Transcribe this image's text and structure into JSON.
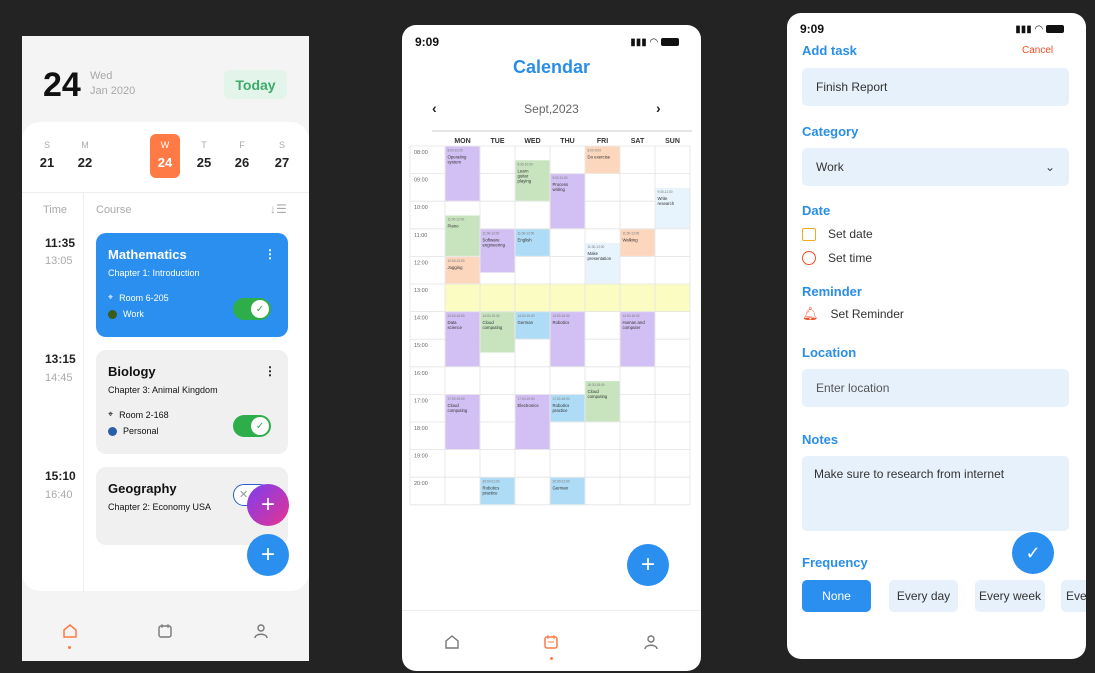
{
  "screen1": {
    "day": "24",
    "weekday": "Wed",
    "month_year": "Jan 2020",
    "today_label": "Today",
    "week": [
      {
        "letter": "S",
        "num": "21"
      },
      {
        "letter": "M",
        "num": "22"
      },
      {
        "letter": "W",
        "num": "24"
      },
      {
        "letter": "T",
        "num": "25"
      },
      {
        "letter": "F",
        "num": "26"
      },
      {
        "letter": "S",
        "num": "27"
      }
    ],
    "col_time": "Time",
    "col_course": "Course",
    "courses": [
      {
        "start": "11:35",
        "end": "13:05",
        "title": "Mathematics",
        "chapter": "Chapter 1: Introduction",
        "room": "Room 6-205",
        "tag": "Work"
      },
      {
        "start": "13:15",
        "end": "14:45",
        "title": "Biology",
        "chapter": "Chapter 3: Animal Kingdom",
        "room": "Room 2-168",
        "tag": "Personal"
      },
      {
        "start": "15:10",
        "end": "16:40",
        "title": "Geography",
        "chapter": "Chapter 2: Economy USA"
      }
    ],
    "colors": {
      "accent": "#ff7a45",
      "blue": "#2b8ff0",
      "green": "#2eae4b"
    }
  },
  "screen2": {
    "time": "9:09",
    "title": "Calendar",
    "month": "Sept,2023",
    "days": [
      "MON",
      "TUE",
      "WED",
      "THU",
      "FRI",
      "SAT",
      "SUN"
    ],
    "hours": [
      "08:00",
      "09:00",
      "10:00",
      "11:00",
      "12:00",
      "13:00",
      "14:00",
      "15:00",
      "16:00",
      "17:00",
      "18:00",
      "19:00",
      "20:00"
    ],
    "events": [
      {
        "title": "Operating system",
        "time": "8:00-10:00"
      },
      {
        "title": "Learn guitar playing",
        "time": "8:30-10:00"
      },
      {
        "title": "Process writing",
        "time": "9:00-11:00"
      },
      {
        "title": "Do exercise",
        "time": "8:00-9:00"
      },
      {
        "title": "Write research",
        "time": "9:30-11:00"
      },
      {
        "title": "Piano",
        "time": "11:00-12:00"
      },
      {
        "title": "Software engineering",
        "time": "11:00-12:00"
      },
      {
        "title": "English",
        "time": "11:00-12:00"
      },
      {
        "title": "Make presentation",
        "time": "11:30-13:00"
      },
      {
        "title": "Walking",
        "time": "11:00-12:00"
      },
      {
        "title": "Jogging",
        "time": "12:00-13:00"
      },
      {
        "title": "Data science",
        "time": "14:00-16:00"
      },
      {
        "title": "Cloud computing",
        "time": "14:00-15:30"
      },
      {
        "title": "German",
        "time": "14:00-15:00"
      },
      {
        "title": "Robotics",
        "time": "14:00-16:00"
      },
      {
        "title": "Human and computer",
        "time": "14:00-16:00"
      },
      {
        "title": "Cloud computing",
        "time": "16:30-18:00"
      },
      {
        "title": "Cloud computing",
        "time": "17:00-19:00"
      },
      {
        "title": "Electronics",
        "time": "17:00-19:00"
      },
      {
        "title": "Robotics practice",
        "time": "17:00-18:00"
      },
      {
        "title": "Robotics practice",
        "time": "20:00-21:00"
      },
      {
        "title": "German",
        "time": "20:00-21:00"
      }
    ],
    "colors": {
      "purple": "#d2bff3",
      "green": "#c8e4bf",
      "blue": "#aedcf6",
      "orange": "#fcd6bd",
      "lightblue": "#e7f3fd",
      "yellow": "#fbfcc2"
    }
  },
  "screen3": {
    "time": "9:09",
    "title": "Add task",
    "cancel": "Cancel",
    "task_value": "Finish Report",
    "category_label": "Category",
    "category_value": "Work",
    "date_label": "Date",
    "set_date": "Set date",
    "set_time": "Set time",
    "reminder_label": "Reminder",
    "set_reminder": "Set Reminder",
    "location_label": "Location",
    "location_placeholder": "Enter location",
    "notes_label": "Notes",
    "notes_value": "Make sure to research from internet",
    "frequency_label": "Frequency",
    "frequency_options": [
      "None",
      "Every day",
      "Every week",
      "Ever"
    ]
  }
}
